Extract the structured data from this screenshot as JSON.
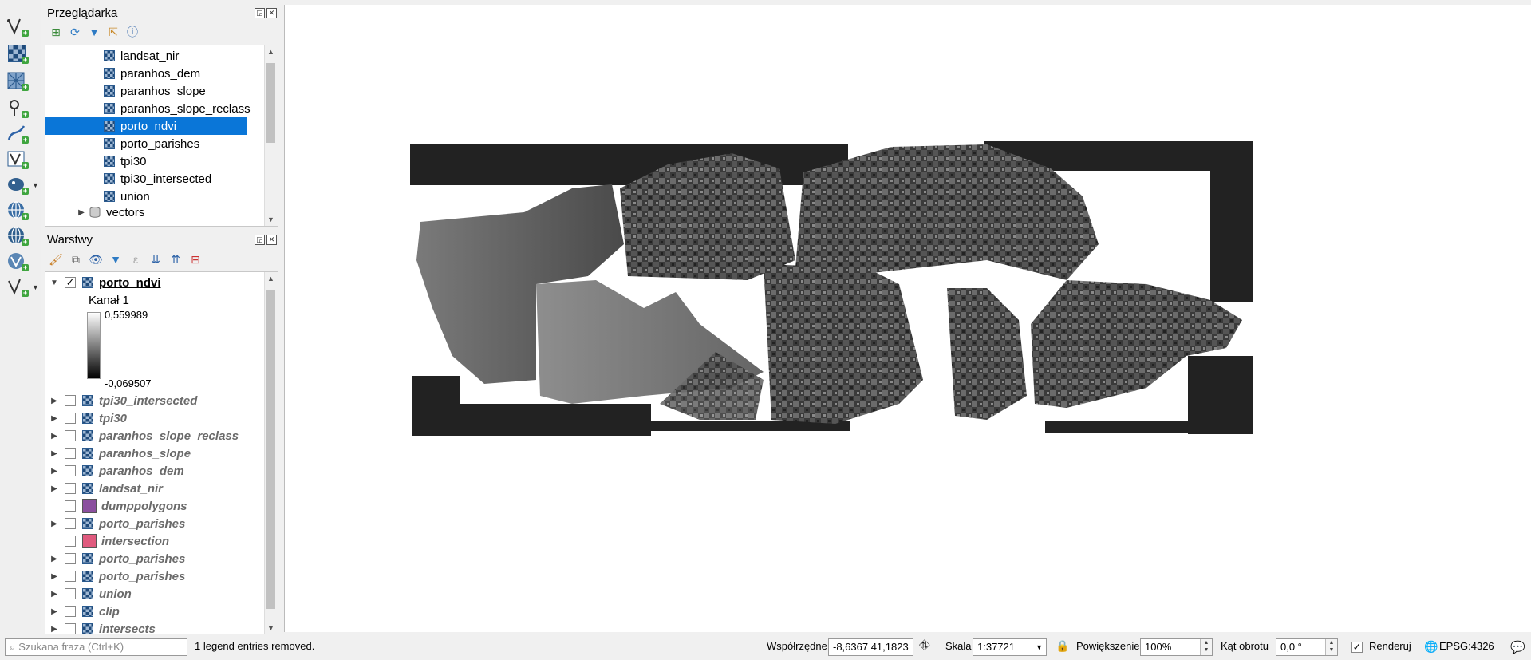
{
  "browser_panel": {
    "title": "Przeglądarka",
    "items": [
      "landsat_nir",
      "paranhos_dem",
      "paranhos_slope",
      "paranhos_slope_reclass",
      "porto_ndvi",
      "porto_parishes",
      "tpi30",
      "tpi30_intersected",
      "union"
    ],
    "selected_index": 4,
    "folder": "vectors"
  },
  "layers_panel": {
    "title": "Warstwy",
    "active_layer": {
      "name": "porto_ndvi",
      "band_label": "Kanał 1",
      "max_value": "0,559989",
      "min_value": "-0,069507"
    },
    "layers": [
      {
        "name": "tpi30_intersected",
        "type": "raster",
        "expandable": true
      },
      {
        "name": "tpi30",
        "type": "raster",
        "expandable": true
      },
      {
        "name": "paranhos_slope_reclass",
        "type": "raster",
        "expandable": true
      },
      {
        "name": "paranhos_slope",
        "type": "raster",
        "expandable": true
      },
      {
        "name": "paranhos_dem",
        "type": "raster",
        "expandable": true
      },
      {
        "name": "landsat_nir",
        "type": "raster",
        "expandable": true
      },
      {
        "name": "dumppolygons",
        "type": "polygon",
        "color": "#8b4f9f",
        "expandable": false
      },
      {
        "name": "porto_parishes",
        "type": "raster",
        "expandable": true
      },
      {
        "name": "intersection",
        "type": "polygon",
        "color": "#e05a7e",
        "expandable": false
      },
      {
        "name": "porto_parishes",
        "type": "raster",
        "expandable": true
      },
      {
        "name": "porto_parishes",
        "type": "raster",
        "expandable": true
      },
      {
        "name": "union",
        "type": "raster",
        "expandable": true
      },
      {
        "name": "clip",
        "type": "raster",
        "expandable": true
      },
      {
        "name": "intersects",
        "type": "raster",
        "expandable": true
      }
    ]
  },
  "statusbar": {
    "search_placeholder": "Szukana fraza (Ctrl+K)",
    "message": "1 legend entries removed.",
    "coords_label": "Współrzędne",
    "coords_value": "-8,6367 41,1823",
    "scale_label": "Skala",
    "scale_value": "1:37721",
    "zoom_label": "Powiększenie",
    "zoom_value": "100%",
    "rotation_label": "Kąt obrotu",
    "rotation_value": "0,0 °",
    "render_label": "Renderuj",
    "crs": "EPSG:4326"
  },
  "colors": {
    "selection": "#0a76d8",
    "legend_top": "#ffffff",
    "legend_bottom": "#000000"
  }
}
